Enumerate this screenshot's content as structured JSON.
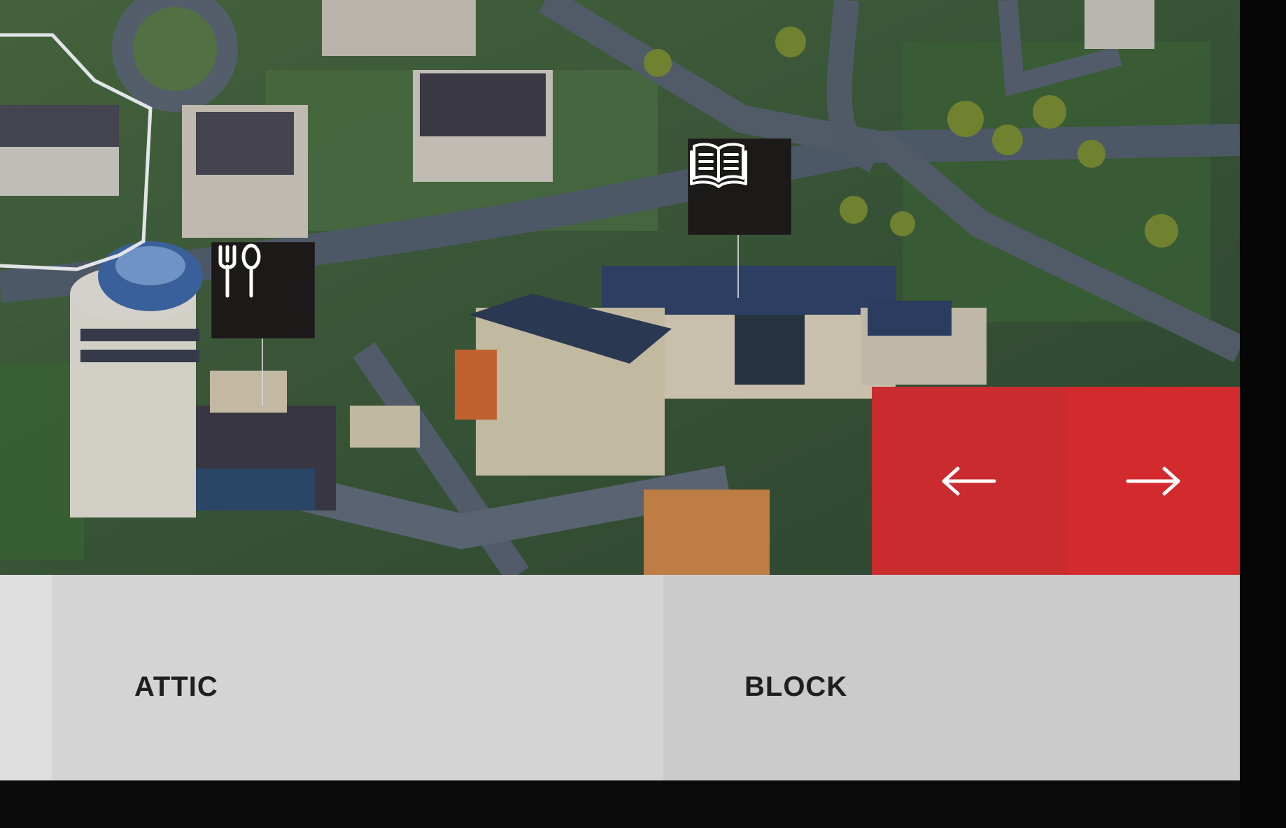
{
  "map": {
    "markers": [
      {
        "id": "restaurant",
        "icon": "fork-spoon-icon"
      },
      {
        "id": "library",
        "icon": "open-book-icon"
      }
    ]
  },
  "slider": {
    "prev_icon": "arrow-left-icon",
    "next_icon": "arrow-right-icon",
    "prev_symbol": "←",
    "next_symbol": "→",
    "accent_color": "#d32a2e"
  },
  "labels": {
    "attic": "ATTIC",
    "block": "BLOCK"
  }
}
